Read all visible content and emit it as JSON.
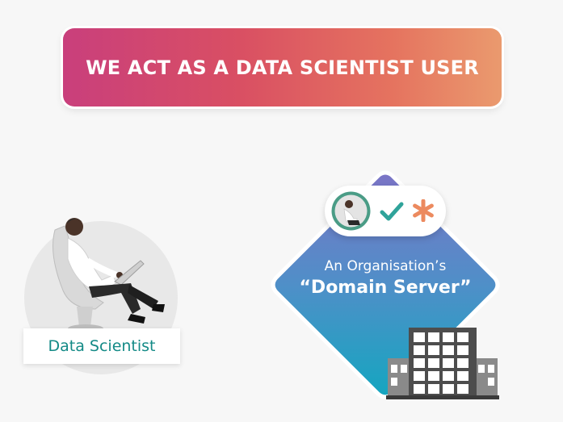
{
  "banner": {
    "title": "WE ACT AS A DATA SCIENTIST USER"
  },
  "data_scientist": {
    "label": "Data Scientist",
    "icon": "person-in-chair-with-laptop"
  },
  "domain_server": {
    "line1": "An Organisation’s",
    "line2": "“Domain Server”",
    "icons": [
      "avatar-icon",
      "check-icon",
      "asterisk-icon",
      "building-icon"
    ]
  },
  "colors": {
    "banner_start": "#c93f7c",
    "banner_end": "#ea9a6e",
    "diamond_top": "#6b7fc8",
    "diamond_bottom": "#14a6c0",
    "label_text": "#138a86",
    "check": "#2fa39a",
    "asterisk": "#ec8a5f"
  }
}
